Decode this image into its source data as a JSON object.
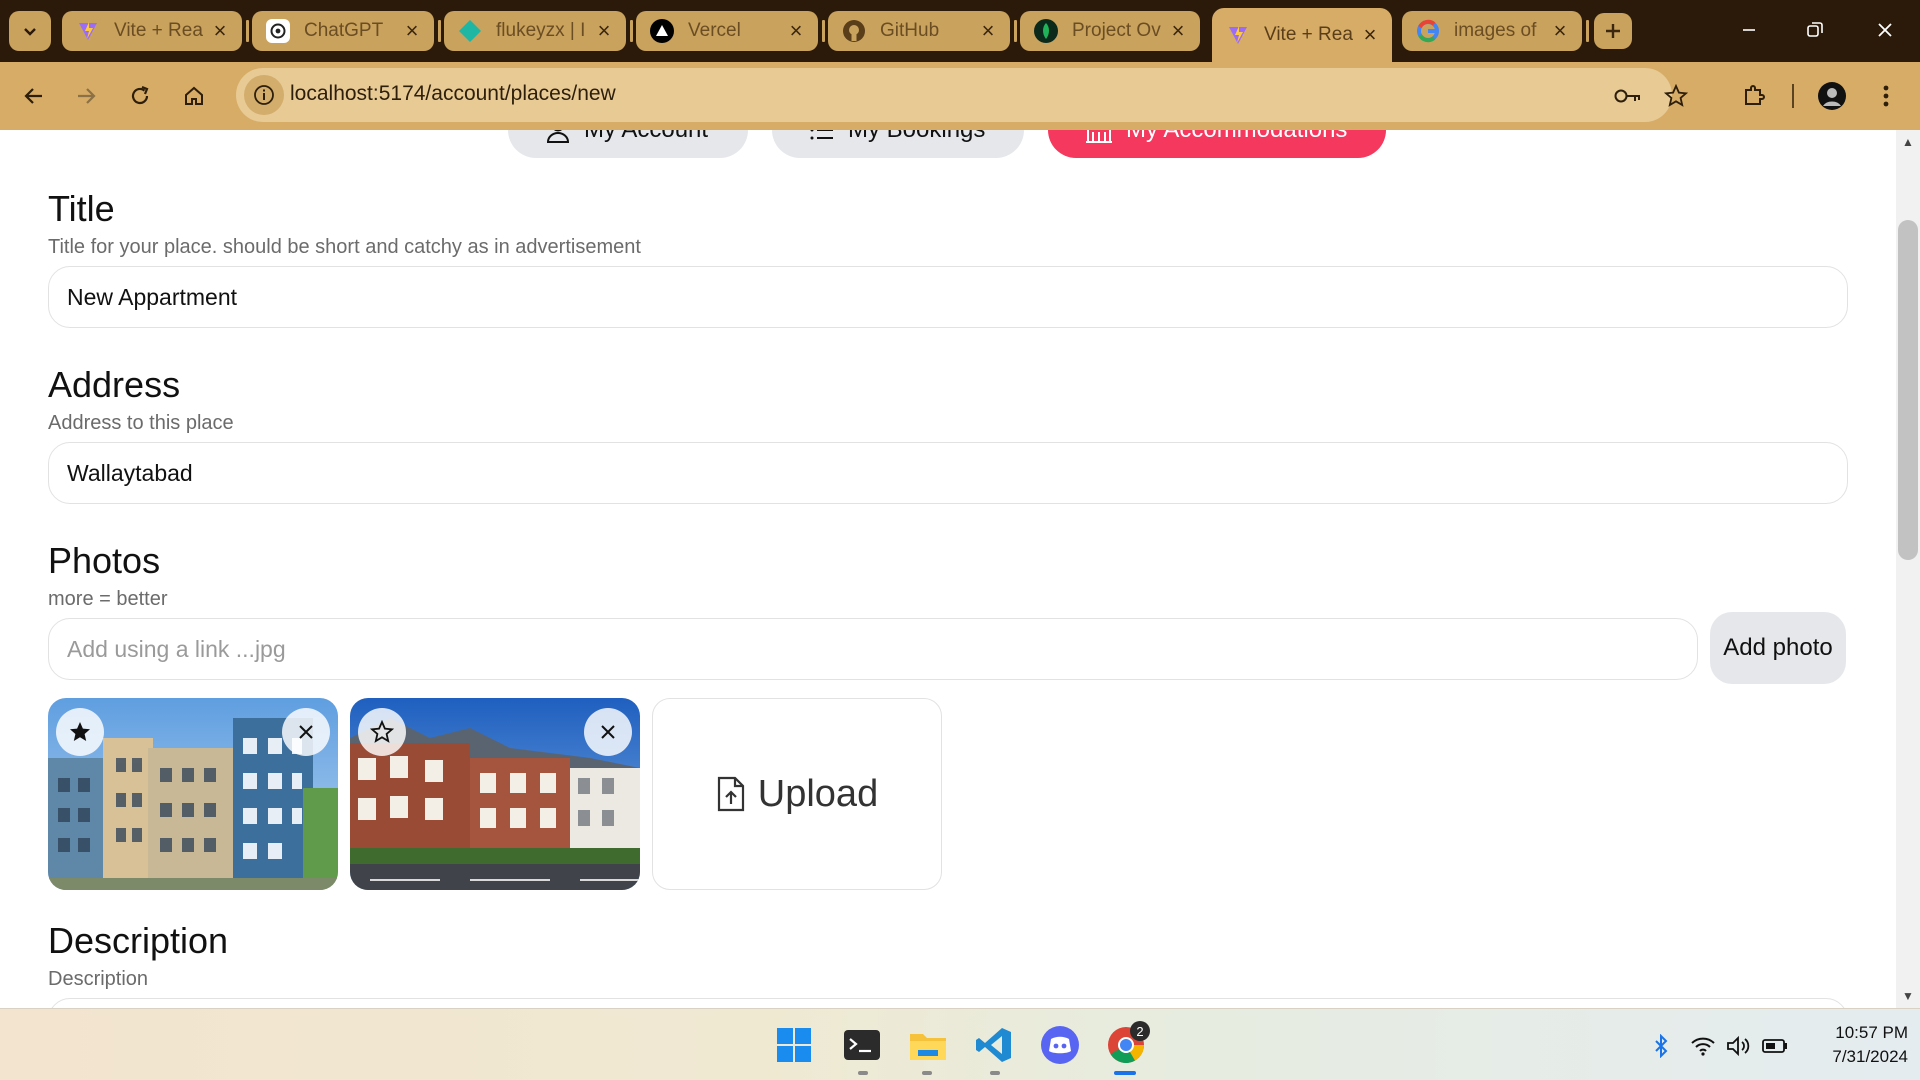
{
  "browser": {
    "tabs": [
      {
        "title": "Vite + Rea",
        "icon": "vite-icon"
      },
      {
        "title": "ChatGPT",
        "icon": "chatgpt-icon"
      },
      {
        "title": "flukeyzx | I",
        "icon": "diamond-icon"
      },
      {
        "title": "Vercel",
        "icon": "vercel-icon"
      },
      {
        "title": "GitHub",
        "icon": "github-icon"
      },
      {
        "title": "Project Ov",
        "icon": "leaf-icon"
      },
      {
        "title": "Vite + Rea",
        "icon": "vite-icon",
        "active": true
      },
      {
        "title": "images of",
        "icon": "google-icon"
      }
    ],
    "url": "localhost:5174/account/places/new"
  },
  "account_nav": {
    "account": "My Account",
    "bookings": "My Bookings",
    "accommodations": "My Accommodations"
  },
  "form": {
    "title_label": "Title",
    "title_hint": "Title for your place. should be short and catchy as in advertisement",
    "title_value": "New Appartment",
    "address_label": "Address",
    "address_hint": "Address to this place",
    "address_value": "Wallaytabad",
    "photos_label": "Photos",
    "photos_hint": "more = better",
    "photo_link_placeholder": "Add using a link ...jpg",
    "add_photo_label": "Add photo",
    "upload_label": "Upload",
    "description_label": "Description",
    "description_hint": "Description"
  },
  "photos": [
    {
      "name": "apartment-photo-1",
      "featured": true
    },
    {
      "name": "apartment-photo-2",
      "featured": false
    }
  ],
  "taskbar": {
    "apps": [
      "windows-start-icon",
      "terminal-icon",
      "file-explorer-icon",
      "vscode-icon",
      "discord-icon",
      "chrome-icon"
    ],
    "chrome_badge": "2",
    "time": "10:57 PM",
    "date": "7/31/2024"
  },
  "colors": {
    "primary": "#f5385d",
    "tabbar": "#2b190a",
    "toolbar": "#d7ac66"
  }
}
